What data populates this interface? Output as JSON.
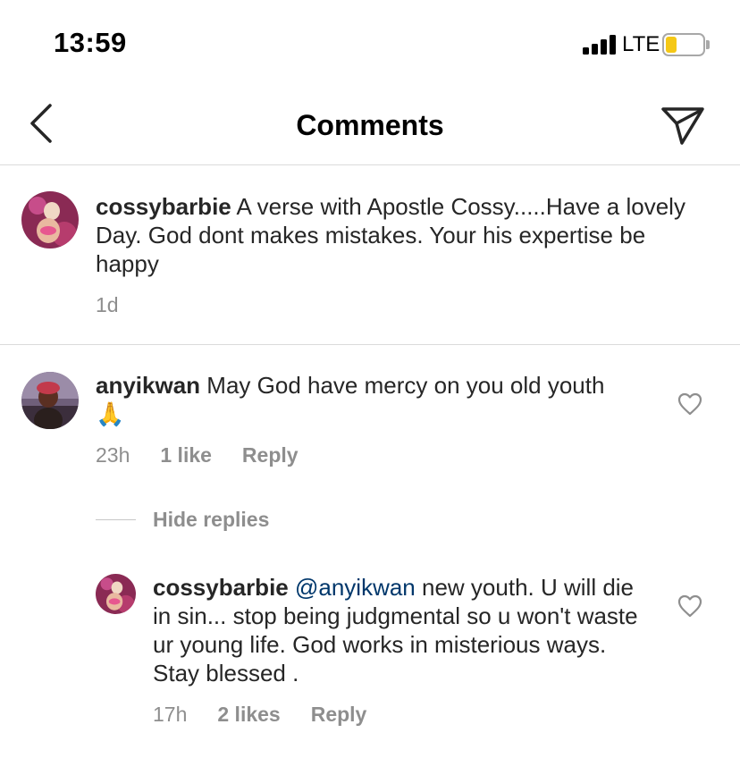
{
  "status_bar": {
    "time": "13:59",
    "network": "LTE",
    "battery_color": "#f5c816"
  },
  "nav": {
    "title": "Comments",
    "back_icon": "chevron-left-icon",
    "share_icon": "paper-plane-icon"
  },
  "caption": {
    "username": "cossybarbie",
    "text": "A verse with Apostle Cossy.....Have a lovely Day.  God dont makes mistakes.  Your his expertise be happy",
    "time": "1d"
  },
  "comment": {
    "username": "anyikwan",
    "text": "May God have mercy on you old youth",
    "emoji": "🙏",
    "time": "23h",
    "likes": "1 like",
    "reply_label": "Reply"
  },
  "replies_toggle": {
    "label": "Hide replies"
  },
  "reply": {
    "username": "cossybarbie",
    "mention": "@anyikwan",
    "text": "new youth. U will die in sin... stop being judgmental so u won't waste ur young life. God works in misterious ways. Stay blessed .",
    "time": "17h",
    "likes": "2 likes",
    "reply_label": "Reply"
  },
  "colors": {
    "text": "#262626",
    "secondary": "#8e8e8e",
    "mention": "#00376b",
    "divider": "#dbdbdb"
  }
}
